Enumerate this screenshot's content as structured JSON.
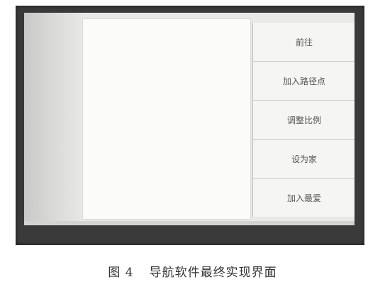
{
  "menu": {
    "items": [
      {
        "label": "前往"
      },
      {
        "label": "加入路径点"
      },
      {
        "label": "调整比例"
      },
      {
        "label": "设为家"
      },
      {
        "label": "加入最爱"
      }
    ]
  },
  "caption": {
    "figure_label": "图 4",
    "text": "导航软件最终实现界面"
  },
  "colors": {
    "frame": "#3a3a3a",
    "screen": "#e9e9e7",
    "map_background": "#fbfbfa",
    "button_background": "#f5f5f3",
    "button_text": "#555555"
  }
}
